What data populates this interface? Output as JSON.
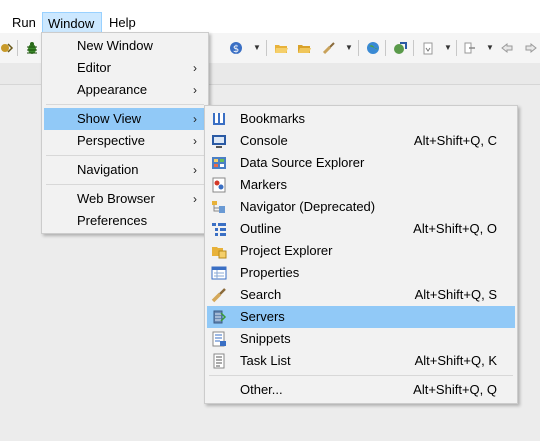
{
  "menubar": {
    "run": "Run",
    "window": "Window",
    "help": "Help"
  },
  "toolbar": {
    "icons": [
      "debug-icon",
      "bug-icon",
      "new-server-icon",
      "open-folder-icon",
      "open-file-icon",
      "search-icon",
      "globe-icon",
      "web-service-icon",
      "annotation-icon",
      "navigate-icon",
      "back-icon",
      "forward-icon"
    ]
  },
  "window_menu": {
    "items": [
      {
        "label": "New Window"
      },
      {
        "label": "Editor"
      },
      {
        "label": "Appearance"
      },
      {
        "label": "Show View"
      },
      {
        "label": "Perspective"
      },
      {
        "label": "Navigation"
      },
      {
        "label": "Web Browser"
      },
      {
        "label": "Preferences"
      }
    ],
    "arrow": "›"
  },
  "show_view_menu": {
    "items": [
      {
        "label": "Bookmarks",
        "accel": "",
        "icon": "bookmarks-icon"
      },
      {
        "label": "Console",
        "accel": "Alt+Shift+Q, C",
        "icon": "console-icon"
      },
      {
        "label": "Data Source Explorer",
        "accel": "",
        "icon": "data-source-explorer-icon"
      },
      {
        "label": "Markers",
        "accel": "",
        "icon": "markers-icon"
      },
      {
        "label": "Navigator (Deprecated)",
        "accel": "",
        "icon": "navigator-icon"
      },
      {
        "label": "Outline",
        "accel": "Alt+Shift+Q, O",
        "icon": "outline-icon"
      },
      {
        "label": "Project Explorer",
        "accel": "",
        "icon": "project-explorer-icon"
      },
      {
        "label": "Properties",
        "accel": "",
        "icon": "properties-icon"
      },
      {
        "label": "Search",
        "accel": "Alt+Shift+Q, S",
        "icon": "search-icon"
      },
      {
        "label": "Servers",
        "accel": "",
        "icon": "servers-icon"
      },
      {
        "label": "Snippets",
        "accel": "",
        "icon": "snippets-icon"
      },
      {
        "label": "Task List",
        "accel": "Alt+Shift+Q, K",
        "icon": "task-list-icon"
      },
      {
        "label": "Other...",
        "accel": "Alt+Shift+Q, Q",
        "icon": ""
      }
    ]
  },
  "colors": {
    "highlight": "#91c9f7",
    "menubar_active": "#cce8ff"
  }
}
